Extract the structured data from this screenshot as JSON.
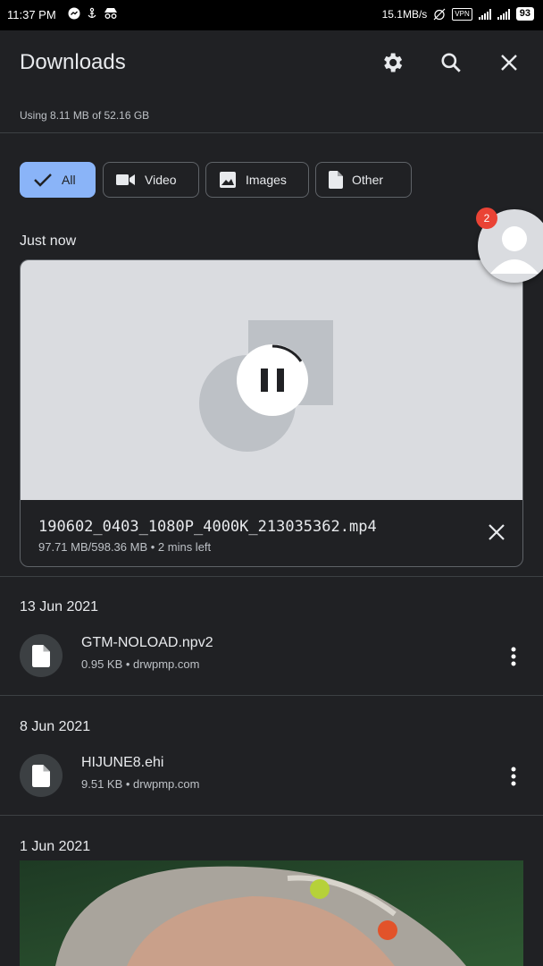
{
  "status_bar": {
    "time": "11:37 PM",
    "network_speed": "15.1MB/s",
    "vpn_label": "VPN",
    "battery": "93"
  },
  "header": {
    "title": "Downloads",
    "settings_icon": "gear-icon",
    "search_icon": "search-icon",
    "close_icon": "close-icon"
  },
  "storage": {
    "usage_text": "Using 8.11 MB of 52.16 GB"
  },
  "filters": {
    "chips": [
      {
        "label": "All",
        "icon": "check-icon",
        "selected": true
      },
      {
        "label": "Video",
        "icon": "video-icon",
        "selected": false
      },
      {
        "label": "Images",
        "icon": "image-icon",
        "selected": false
      },
      {
        "label": "Other",
        "icon": "file-icon",
        "selected": false
      }
    ]
  },
  "bubble": {
    "badge_count": "2"
  },
  "sections": {
    "just_now": {
      "label": "Just now",
      "active_download": {
        "filename": "190602_0403_1080P_4000K_213035362.mp4",
        "meta": "97.71 MB/598.36 MB • 2 mins left",
        "progress": 0.163
      }
    },
    "jun13": {
      "label": "13 Jun 2021",
      "file": {
        "name": "GTM-NOLOAD.npv2",
        "meta": "0.95 KB • drwpmp.com"
      }
    },
    "jun8": {
      "label": "8 Jun 2021",
      "file": {
        "name": "HIJUNE8.ehi",
        "meta": "9.51 KB • drwpmp.com"
      }
    },
    "jun1": {
      "label": "1 Jun 2021"
    }
  },
  "colors": {
    "background": "#202124",
    "accent": "#8ab4f8",
    "badge": "#ea4335",
    "card_thumb": "#dadce0"
  }
}
